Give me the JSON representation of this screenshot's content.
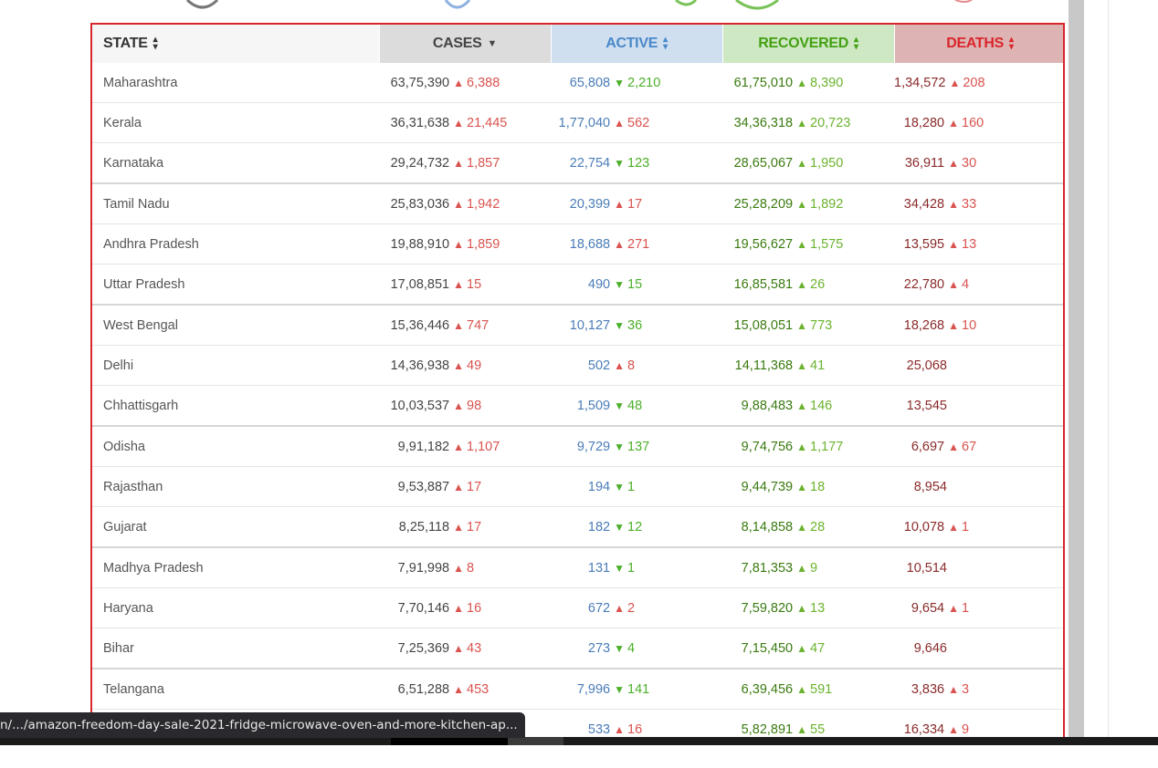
{
  "headers": {
    "state": "STATE",
    "cases": "CASES",
    "active": "ACTIVE",
    "recovered": "RECOVERED",
    "deaths": "DEATHS"
  },
  "rows": [
    {
      "state": "Maharashtra",
      "cases": "63,75,390",
      "cases_delta": "6,388",
      "active": "65,808",
      "active_delta": "2,210",
      "active_dir": "down",
      "recovered": "61,75,010",
      "recovered_delta": "8,390",
      "deaths": "1,34,572",
      "deaths_delta": "208"
    },
    {
      "state": "Kerala",
      "cases": "36,31,638",
      "cases_delta": "21,445",
      "active": "1,77,040",
      "active_delta": "562",
      "active_dir": "up",
      "recovered": "34,36,318",
      "recovered_delta": "20,723",
      "deaths": "18,280",
      "deaths_delta": "160"
    },
    {
      "state": "Karnataka",
      "cases": "29,24,732",
      "cases_delta": "1,857",
      "active": "22,754",
      "active_delta": "123",
      "active_dir": "down",
      "recovered": "28,65,067",
      "recovered_delta": "1,950",
      "deaths": "36,911",
      "deaths_delta": "30"
    },
    {
      "state": "Tamil Nadu",
      "cases": "25,83,036",
      "cases_delta": "1,942",
      "active": "20,399",
      "active_delta": "17",
      "active_dir": "up",
      "recovered": "25,28,209",
      "recovered_delta": "1,892",
      "deaths": "34,428",
      "deaths_delta": "33"
    },
    {
      "state": "Andhra Pradesh",
      "cases": "19,88,910",
      "cases_delta": "1,859",
      "active": "18,688",
      "active_delta": "271",
      "active_dir": "up",
      "recovered": "19,56,627",
      "recovered_delta": "1,575",
      "deaths": "13,595",
      "deaths_delta": "13"
    },
    {
      "state": "Uttar Pradesh",
      "cases": "17,08,851",
      "cases_delta": "15",
      "active": "490",
      "active_delta": "15",
      "active_dir": "down",
      "recovered": "16,85,581",
      "recovered_delta": "26",
      "deaths": "22,780",
      "deaths_delta": "4"
    },
    {
      "state": "West Bengal",
      "cases": "15,36,446",
      "cases_delta": "747",
      "active": "10,127",
      "active_delta": "36",
      "active_dir": "down",
      "recovered": "15,08,051",
      "recovered_delta": "773",
      "deaths": "18,268",
      "deaths_delta": "10"
    },
    {
      "state": "Delhi",
      "cases": "14,36,938",
      "cases_delta": "49",
      "active": "502",
      "active_delta": "8",
      "active_dir": "up",
      "recovered": "14,11,368",
      "recovered_delta": "41",
      "deaths": "25,068",
      "deaths_delta": ""
    },
    {
      "state": "Chhattisgarh",
      "cases": "10,03,537",
      "cases_delta": "98",
      "active": "1,509",
      "active_delta": "48",
      "active_dir": "down",
      "recovered": "9,88,483",
      "recovered_delta": "146",
      "deaths": "13,545",
      "deaths_delta": ""
    },
    {
      "state": "Odisha",
      "cases": "9,91,182",
      "cases_delta": "1,107",
      "active": "9,729",
      "active_delta": "137",
      "active_dir": "down",
      "recovered": "9,74,756",
      "recovered_delta": "1,177",
      "deaths": "6,697",
      "deaths_delta": "67"
    },
    {
      "state": "Rajasthan",
      "cases": "9,53,887",
      "cases_delta": "17",
      "active": "194",
      "active_delta": "1",
      "active_dir": "down",
      "recovered": "9,44,739",
      "recovered_delta": "18",
      "deaths": "8,954",
      "deaths_delta": ""
    },
    {
      "state": "Gujarat",
      "cases": "8,25,118",
      "cases_delta": "17",
      "active": "182",
      "active_delta": "12",
      "active_dir": "down",
      "recovered": "8,14,858",
      "recovered_delta": "28",
      "deaths": "10,078",
      "deaths_delta": "1"
    },
    {
      "state": "Madhya Pradesh",
      "cases": "7,91,998",
      "cases_delta": "8",
      "active": "131",
      "active_delta": "1",
      "active_dir": "down",
      "recovered": "7,81,353",
      "recovered_delta": "9",
      "deaths": "10,514",
      "deaths_delta": ""
    },
    {
      "state": "Haryana",
      "cases": "7,70,146",
      "cases_delta": "16",
      "active": "672",
      "active_delta": "2",
      "active_dir": "up",
      "recovered": "7,59,820",
      "recovered_delta": "13",
      "deaths": "9,654",
      "deaths_delta": "1"
    },
    {
      "state": "Bihar",
      "cases": "7,25,369",
      "cases_delta": "43",
      "active": "273",
      "active_delta": "4",
      "active_dir": "down",
      "recovered": "7,15,450",
      "recovered_delta": "47",
      "deaths": "9,646",
      "deaths_delta": ""
    },
    {
      "state": "Telangana",
      "cases": "6,51,288",
      "cases_delta": "453",
      "active": "7,996",
      "active_delta": "141",
      "active_dir": "down",
      "recovered": "6,39,456",
      "recovered_delta": "591",
      "deaths": "3,836",
      "deaths_delta": "3"
    },
    {
      "state": "",
      "cases": "",
      "cases_delta": "",
      "active": "533",
      "active_delta": "16",
      "active_dir": "up",
      "recovered": "5,82,891",
      "recovered_delta": "55",
      "deaths": "16,334",
      "deaths_delta": "9"
    }
  ],
  "status_url": "n/.../amazon-freedom-day-sale-2021-fridge-microwave-oven-and-more-kitchen-ap...",
  "colors": {
    "frame": "#d9262c",
    "active": "#4a88c8",
    "recovered": "#43a012",
    "deaths": "#d9262c"
  }
}
